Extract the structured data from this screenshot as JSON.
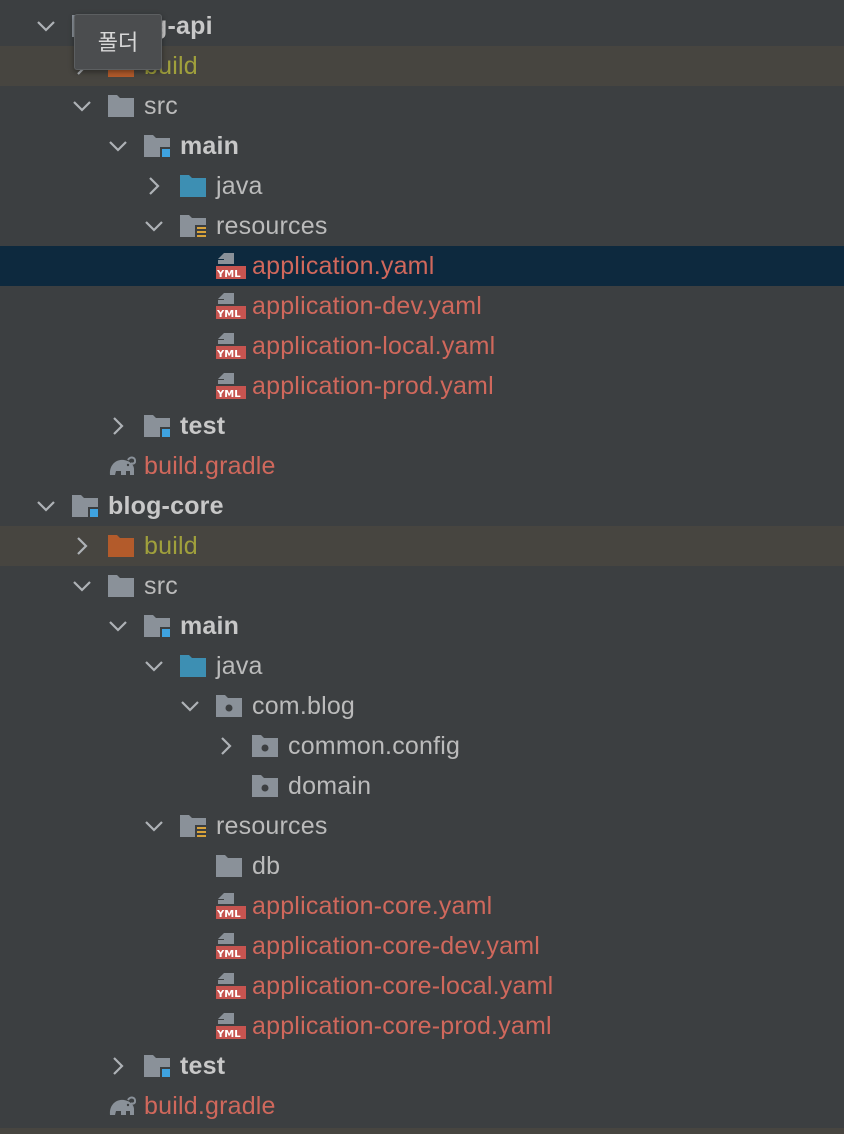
{
  "tooltip": "폴더",
  "modules": [
    {
      "name": "blog-api",
      "visible_label": "g-api",
      "build_dir": "build",
      "src": "src",
      "main": "main",
      "java": "java",
      "resources": "resources",
      "yaml_files": [
        "application.yaml",
        "application-dev.yaml",
        "application-local.yaml",
        "application-prod.yaml"
      ],
      "test": "test",
      "gradle": "build.gradle"
    },
    {
      "name": "blog-core",
      "build_dir": "build",
      "src": "src",
      "main": "main",
      "java": "java",
      "package": "com.blog",
      "subpackages": [
        "common.config",
        "domain"
      ],
      "resources": "resources",
      "db": "db",
      "yaml_files": [
        "application-core.yaml",
        "application-core-dev.yaml",
        "application-core-local.yaml",
        "application-core-prod.yaml"
      ],
      "test": "test",
      "gradle": "build.gradle"
    }
  ],
  "selected_file": "application.yaml",
  "colors": {
    "background": "#3c3f41",
    "selection": "#0d293e",
    "excluded_row": "#474540",
    "untracked_text": "#d0685c",
    "excluded_text": "#a0a03c",
    "folder_grey": "#8a9199",
    "source_root_blue": "#3d8fb3",
    "module_marker": "#3fa3e0",
    "build_folder": "#b35b2b"
  }
}
